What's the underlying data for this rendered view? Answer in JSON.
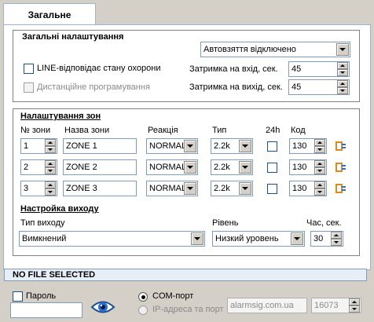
{
  "tab_label": "Загальне",
  "general": {
    "title": "Загальні налаштування",
    "auto_arm_value": "Автовзяття відключено",
    "line_label": "LINE-відповідає стану охорони",
    "remote_label": "Дистанційне програмування",
    "entry_delay_label": "Затримка на вхід, сек.",
    "entry_delay_value": "45",
    "exit_delay_label": "Затримка на вихід, сек.",
    "exit_delay_value": "45"
  },
  "zones": {
    "title": "Налаштування зон",
    "headers": {
      "num": "№ зони",
      "name": "Назва зони",
      "reaction": "Реакція",
      "type": "Тип",
      "h24": "24h",
      "code": "Код"
    },
    "rows": [
      {
        "num": "1",
        "name": "ZONE 1",
        "reaction": "NORMAL",
        "type": "2.2k",
        "code": "130"
      },
      {
        "num": "2",
        "name": "ZONE 2",
        "reaction": "NORMAL",
        "type": "2.2k",
        "code": "130"
      },
      {
        "num": "3",
        "name": "ZONE 3",
        "reaction": "NORMAL",
        "type": "2.2k",
        "code": "130"
      }
    ]
  },
  "output": {
    "title": "Настройка виходу",
    "type_label": "Тип виходу",
    "type_value": "Вимкнений",
    "level_label": "Рівень",
    "level_value": "Низкий уровень",
    "time_label": "Час, сек.",
    "time_value": "30"
  },
  "status": "NO FILE SELECTED",
  "bottom": {
    "password_label": "Пароль",
    "password_value": "",
    "com_label": "COM-порт",
    "ip_label": "IP-адреса та порт",
    "ip_value": "alarmsig.com.ua",
    "port_value": "16073"
  },
  "colors": {
    "panel_border": "#9bb3d4",
    "status_bg": "#e8eef7",
    "icon_orange": "#e08a1e",
    "icon_blue": "#2a6fd6"
  }
}
